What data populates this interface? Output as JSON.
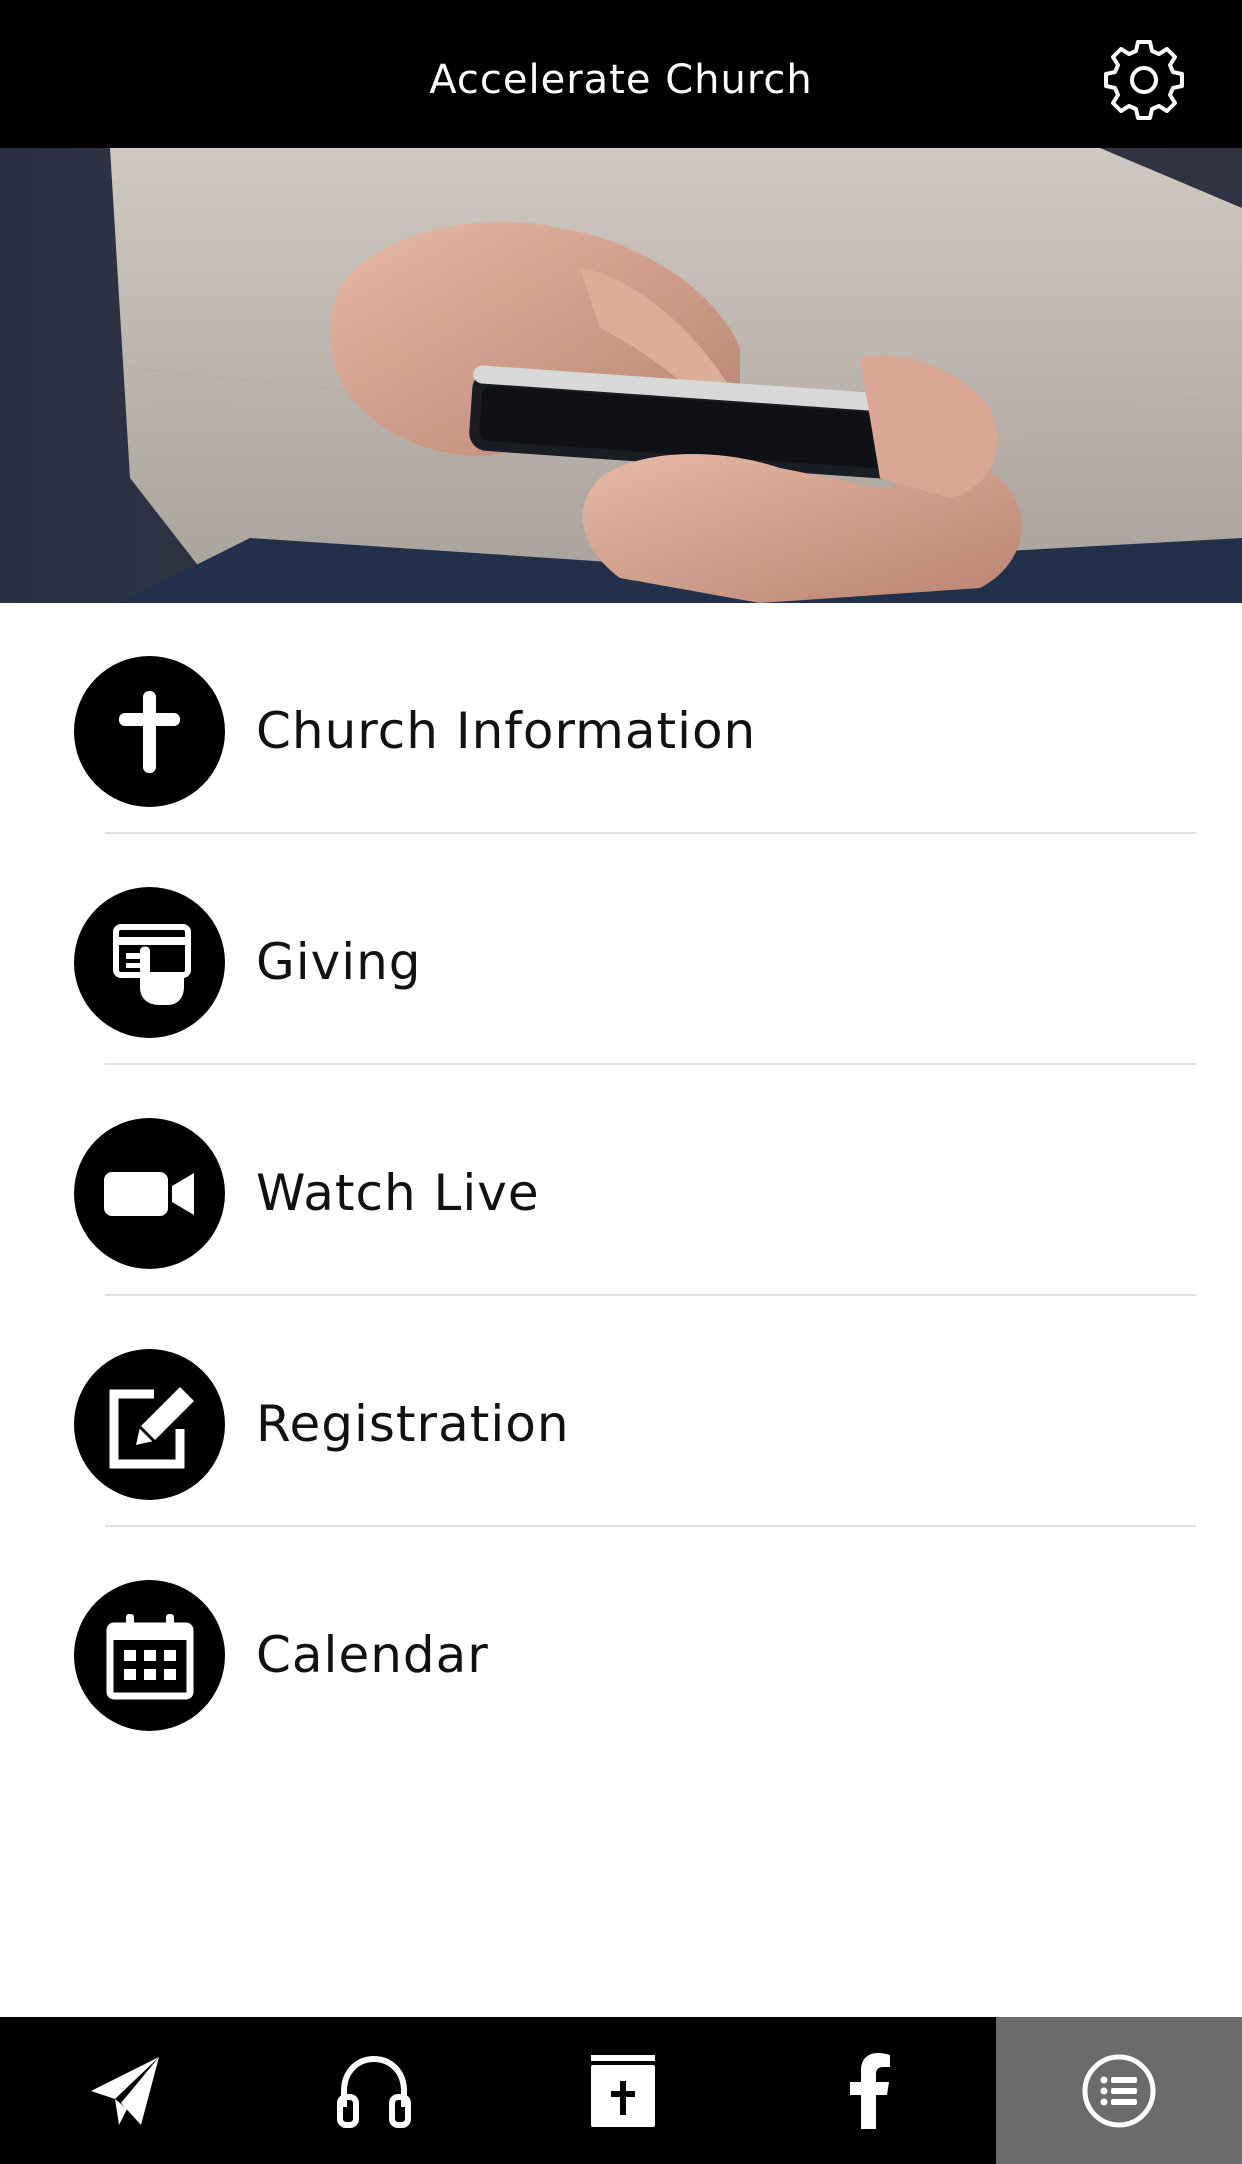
{
  "header": {
    "title": "Accelerate Church",
    "settings_icon": "gear-icon"
  },
  "hero": {
    "description_icon": "hands-holding-phone-photo"
  },
  "menu": {
    "items": [
      {
        "label": "Church Information",
        "icon": "cross-icon"
      },
      {
        "label": "Giving",
        "icon": "card-payment-icon"
      },
      {
        "label": "Watch Live",
        "icon": "video-camera-icon"
      },
      {
        "label": "Registration",
        "icon": "edit-form-icon"
      },
      {
        "label": "Calendar",
        "icon": "calendar-icon"
      }
    ]
  },
  "tabbar": {
    "tabs": [
      {
        "icon": "paper-plane-icon",
        "active": false
      },
      {
        "icon": "headphones-icon",
        "active": false
      },
      {
        "icon": "bible-icon",
        "active": false
      },
      {
        "icon": "facebook-icon",
        "active": false
      },
      {
        "icon": "list-icon",
        "active": true
      }
    ],
    "active_color": "#6b6b6b"
  },
  "colors": {
    "bar_background": "#000000",
    "page_background": "#ffffff",
    "text": "#111111"
  }
}
